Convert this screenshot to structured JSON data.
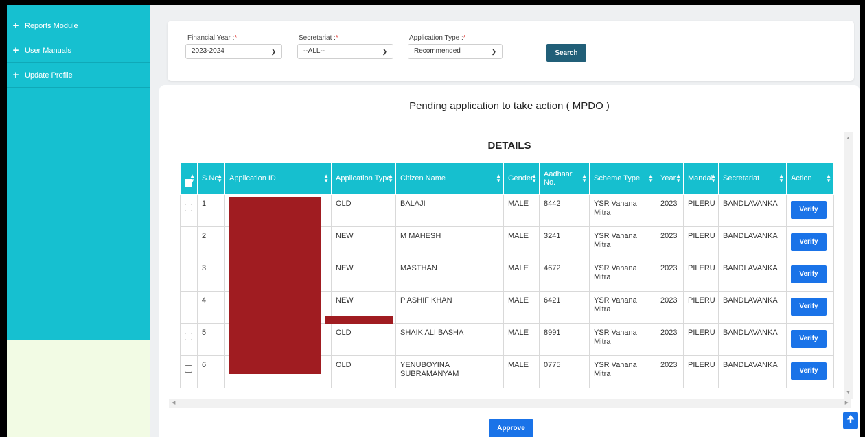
{
  "sidebar": {
    "items": [
      {
        "label": "Reports Module",
        "icon": "plus-icon"
      },
      {
        "label": "User Manuals",
        "icon": "plus-icon"
      },
      {
        "label": "Update Profile",
        "icon": "plus-icon"
      }
    ]
  },
  "filters": {
    "financial_year": {
      "label": "Financial Year :",
      "required": "*",
      "value": "2023-2024"
    },
    "secretariat": {
      "label": "Secretariat :",
      "required": "*",
      "value": "--ALL--"
    },
    "application_type": {
      "label": "Application Type :",
      "required": "*",
      "value": "Recommended"
    },
    "search_label": "Search"
  },
  "page_title": "Pending application to take action ( MPDO )",
  "details_title": "DETAILS",
  "table": {
    "headers": [
      "S.No",
      "Application ID",
      "Application Type",
      "Citizen Name",
      "Gender",
      "Aadhaar No.",
      "Scheme Type",
      "Year",
      "Mandal",
      "Secretariat",
      "Action"
    ],
    "rows": [
      {
        "sno": "1",
        "app_type": "OLD",
        "name": "BALAJI",
        "gender": "MALE",
        "aadhaar": "8442",
        "scheme": "YSR Vahana Mitra",
        "year": "2023",
        "mandal": "PILERU",
        "secretariat": "BANDLAVANKA",
        "action": "Verify",
        "checkbox": true
      },
      {
        "sno": "2",
        "app_type": "NEW",
        "name": "M MAHESH",
        "gender": "MALE",
        "aadhaar": "3241",
        "scheme": "YSR Vahana Mitra",
        "year": "2023",
        "mandal": "PILERU",
        "secretariat": "BANDLAVANKA",
        "action": "Verify",
        "checkbox": false
      },
      {
        "sno": "3",
        "app_type": "NEW",
        "name": "MASTHAN",
        "gender": "MALE",
        "aadhaar": "4672",
        "scheme": "YSR Vahana Mitra",
        "year": "2023",
        "mandal": "PILERU",
        "secretariat": "BANDLAVANKA",
        "action": "Verify",
        "checkbox": false
      },
      {
        "sno": "4",
        "app_type": "NEW",
        "name": "P ASHIF KHAN",
        "gender": "MALE",
        "aadhaar": "6421",
        "scheme": "YSR Vahana Mitra",
        "year": "2023",
        "mandal": "PILERU",
        "secretariat": "BANDLAVANKA",
        "action": "Verify",
        "checkbox": false
      },
      {
        "sno": "5",
        "app_type": "OLD",
        "name": "SHAIK ALI BASHA",
        "gender": "MALE",
        "aadhaar": "8991",
        "scheme": "YSR Vahana Mitra",
        "year": "2023",
        "mandal": "PILERU",
        "secretariat": "BANDLAVANKA",
        "action": "Verify",
        "checkbox": true
      },
      {
        "sno": "6",
        "app_type": "OLD",
        "name": "YENUBOYINA SUBRAMANYAM",
        "gender": "MALE",
        "aadhaar": "0775",
        "scheme": "YSR Vahana Mitra",
        "year": "2023",
        "mandal": "PILERU",
        "secretariat": "BANDLAVANKA",
        "action": "Verify",
        "checkbox": true
      }
    ]
  },
  "approve_label": "Approve",
  "colors": {
    "sidebar": "#16c0d0",
    "header": "#16bfcf",
    "search": "#215f78",
    "verify": "#1a73e8",
    "redaction": "#a01c21"
  }
}
